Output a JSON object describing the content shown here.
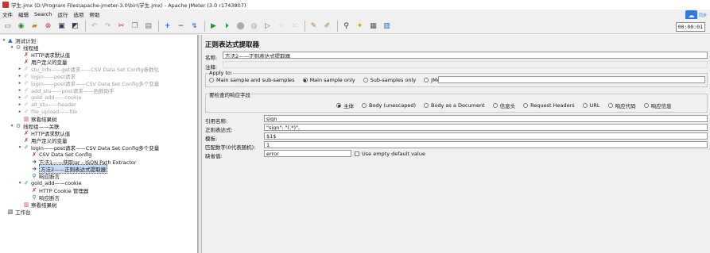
{
  "window": {
    "title": "学生.jmx (D:\\Program Files\\apache-jmeter-3.0\\bin\\学生.jmx) - Apache JMeter (3.0 r1743807)"
  },
  "menu": [
    "文件",
    "编辑",
    "Search",
    "运行",
    "选项",
    "帮助"
  ],
  "cloud": {
    "label": "同步"
  },
  "toolbar": {
    "icons": [
      "new-icon",
      "template-icon",
      "open-icon",
      "close-icon",
      "save-icon",
      "save-as-icon",
      "cut-icon",
      "copy-icon",
      "paste-icon",
      "expand-icon",
      "collapse-icon",
      "toggle-icon",
      "start-icon",
      "start-no-pause-icon",
      "stop-icon",
      "shutdown-icon",
      "remote-start-icon",
      "remote-stop-icon",
      "remote-shutdown-icon",
      "clear-icon",
      "clear-all-icon",
      "search-icon",
      "reset-search-icon",
      "function-helper-icon",
      "help-icon"
    ],
    "timer": "00:00:01"
  },
  "tree": [
    {
      "label": "测试计划",
      "disabled": false
    },
    {
      "label": "线程组",
      "disabled": false
    },
    {
      "label": "HTTP请求默认值",
      "disabled": false
    },
    {
      "label": "用户定义的变量",
      "disabled": false
    },
    {
      "label": "stu_info——get请求——CSV Data Set Config参数化",
      "disabled": true
    },
    {
      "label": "login——post请求",
      "disabled": true
    },
    {
      "label": "login——post请求——CSV Data Set Config多个变量",
      "disabled": true
    },
    {
      "label": "add_stu——post请求——函数助手",
      "disabled": true
    },
    {
      "label": "gold_add——cookie",
      "disabled": true
    },
    {
      "label": "all_stu——header",
      "disabled": true
    },
    {
      "label": "file_upload——file",
      "disabled": true
    },
    {
      "label": "察看结果树",
      "disabled": false
    },
    {
      "label": "线程组——关联",
      "disabled": false
    },
    {
      "label": "HTTP请求默认值",
      "disabled": false
    },
    {
      "label": "用户定义的变量",
      "disabled": false
    },
    {
      "label": "login——post请求——CSV Data Set Config多个变量",
      "disabled": false
    },
    {
      "label": "CSV Data Set Config",
      "disabled": false
    },
    {
      "label": "方法1——获取jar - JSON Path Extractor",
      "disabled": false
    },
    {
      "label": "方法2——正则表达式提取器",
      "disabled": false,
      "selected": true
    },
    {
      "label": "响应断言",
      "disabled": false
    },
    {
      "label": "gold_add——cookie",
      "disabled": false
    },
    {
      "label": "HTTP Cookie 管理器",
      "disabled": false
    },
    {
      "label": "响应断言",
      "disabled": false
    },
    {
      "label": "察看结果树",
      "disabled": false
    },
    {
      "label": "工作台",
      "disabled": false
    }
  ],
  "panel": {
    "title": "正则表达式提取器",
    "name_label": "名称:",
    "name_value": "方法2——正则表达式提取器",
    "comment_label": "注释:",
    "comment_value": "",
    "apply_to": {
      "legend": "Apply to:",
      "options": [
        "Main sample and sub-samples",
        "Main sample only",
        "Sub-samples only",
        "JMeter Variable"
      ],
      "selected": "Main sample only",
      "variable_value": ""
    },
    "field_check": {
      "legend": "要检查的响应字段",
      "options": [
        "主体",
        "Body (unescaped)",
        "Body as a Document",
        "信息头",
        "Request Headers",
        "URL",
        "响应代码",
        "响应信息"
      ],
      "selected": "主体"
    },
    "fields": [
      {
        "label": "引用名称:",
        "value": "sign"
      },
      {
        "label": "正则表达式:",
        "value": "\"sign\": \"(.*)\","
      },
      {
        "label": "模板:",
        "value": "$1$"
      },
      {
        "label": "匹配数字(0代表随机):",
        "value": "1"
      },
      {
        "label": "缺省值:",
        "value": "error"
      }
    ],
    "empty_default": "Use empty default value"
  }
}
